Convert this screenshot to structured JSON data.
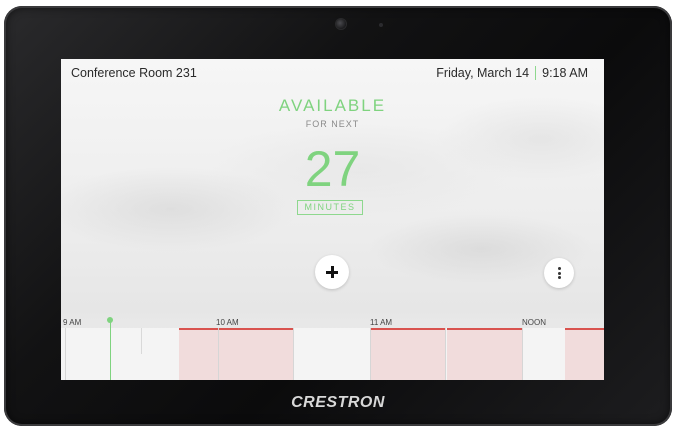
{
  "device": {
    "brand": "CRESTRON"
  },
  "header": {
    "room_name": "Conference Room 231",
    "date": "Friday, March 14",
    "time": "9:18 AM"
  },
  "status": {
    "label": "AVAILABLE",
    "sublabel": "FOR NEXT",
    "value": "27",
    "unit": "MINUTES"
  },
  "actions": {
    "add_icon": "plus-icon",
    "more_icon": "vertical-ellipsis-icon"
  },
  "timeline": {
    "labels": [
      "9 AM",
      "10 AM",
      "11 AM",
      "NOON"
    ],
    "current_time": "9:18 AM",
    "colors": {
      "available": "#f4f4f4",
      "booked": "#f1dcdc",
      "booked_line": "#d9534f",
      "now": "#7fd37f"
    }
  },
  "colors": {
    "accent": "#7fd37f"
  }
}
